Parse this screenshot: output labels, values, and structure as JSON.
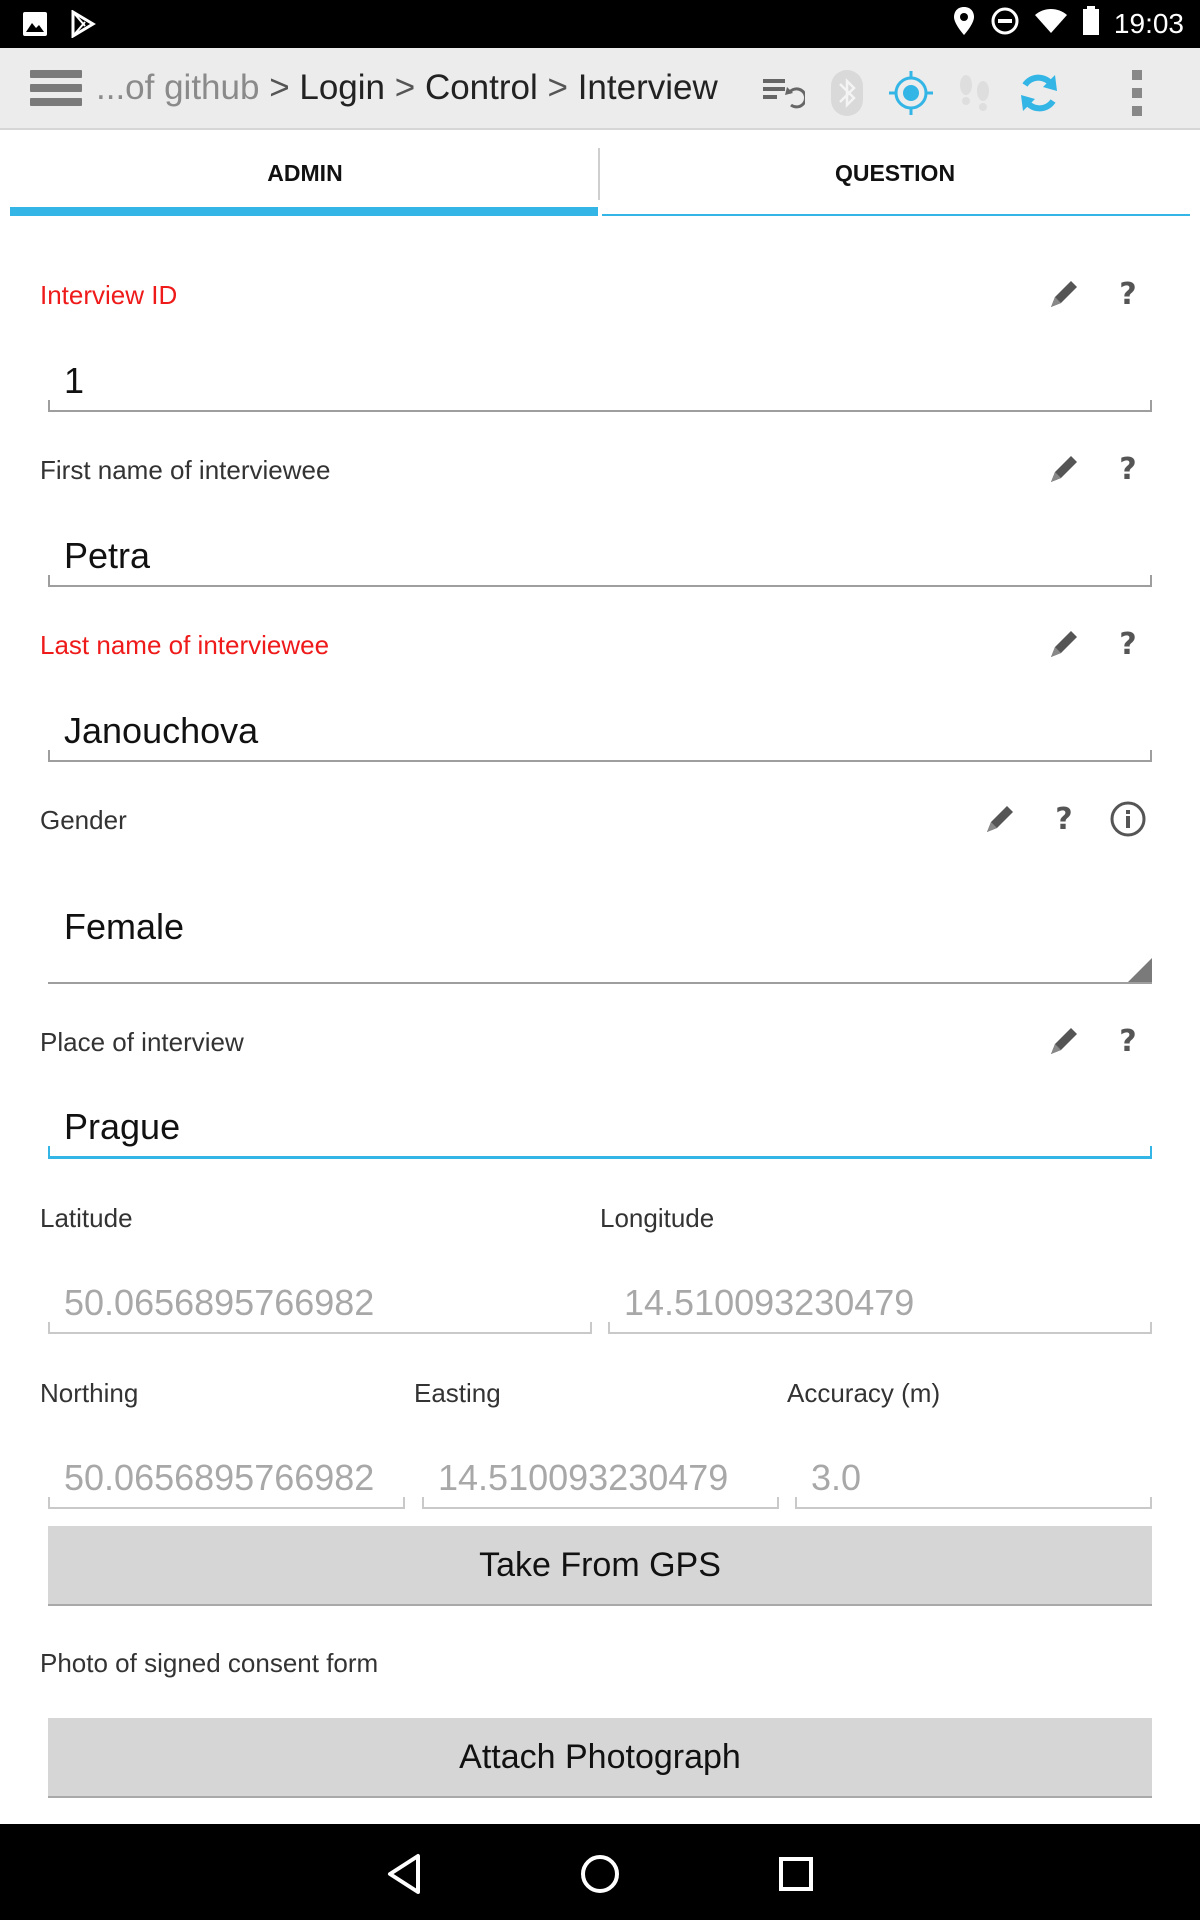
{
  "status_bar": {
    "time": "19:03",
    "icons": [
      "image-icon",
      "play-store-icon",
      "location-pin-icon",
      "do-not-disturb-icon",
      "wifi-icon",
      "battery-icon"
    ]
  },
  "toolbar": {
    "breadcrumb_prefix": "...of github",
    "breadcrumb_sep": ">",
    "breadcrumbs": [
      "Login",
      "Control",
      "Interview"
    ],
    "icons": [
      "sync-list-icon",
      "bluetooth-icon",
      "gps-target-icon",
      "footsteps-icon",
      "refresh-icon",
      "overflow-menu-icon"
    ],
    "accent": "#33b5e5"
  },
  "tabs": [
    {
      "label": "ADMIN",
      "active": true
    },
    {
      "label": "QUESTION",
      "active": false
    }
  ],
  "form": {
    "interview_id": {
      "label": "Interview ID",
      "value": "1",
      "required": true
    },
    "first_name": {
      "label": "First name of interviewee",
      "value": "Petra",
      "required": false
    },
    "last_name": {
      "label": "Last name of interviewee",
      "value": "Janouchova",
      "required": true
    },
    "gender": {
      "label": "Gender",
      "value": "Female"
    },
    "place": {
      "label": "Place of interview",
      "value": "Prague"
    },
    "latitude": {
      "label": "Latitude",
      "value": "50.0656895766982"
    },
    "longitude": {
      "label": "Longitude",
      "value": "14.510093230479"
    },
    "northing": {
      "label": "Northing",
      "value": "50.0656895766982"
    },
    "easting": {
      "label": "Easting",
      "value": "14.510093230479"
    },
    "accuracy": {
      "label": "Accuracy (m)",
      "value": "3.0"
    },
    "gps_button": "Take From GPS",
    "photo_label": "Photo of signed consent form",
    "photo_button": "Attach Photograph"
  },
  "colors": {
    "required_label": "#ef1a1a",
    "accent": "#33b5e5"
  }
}
